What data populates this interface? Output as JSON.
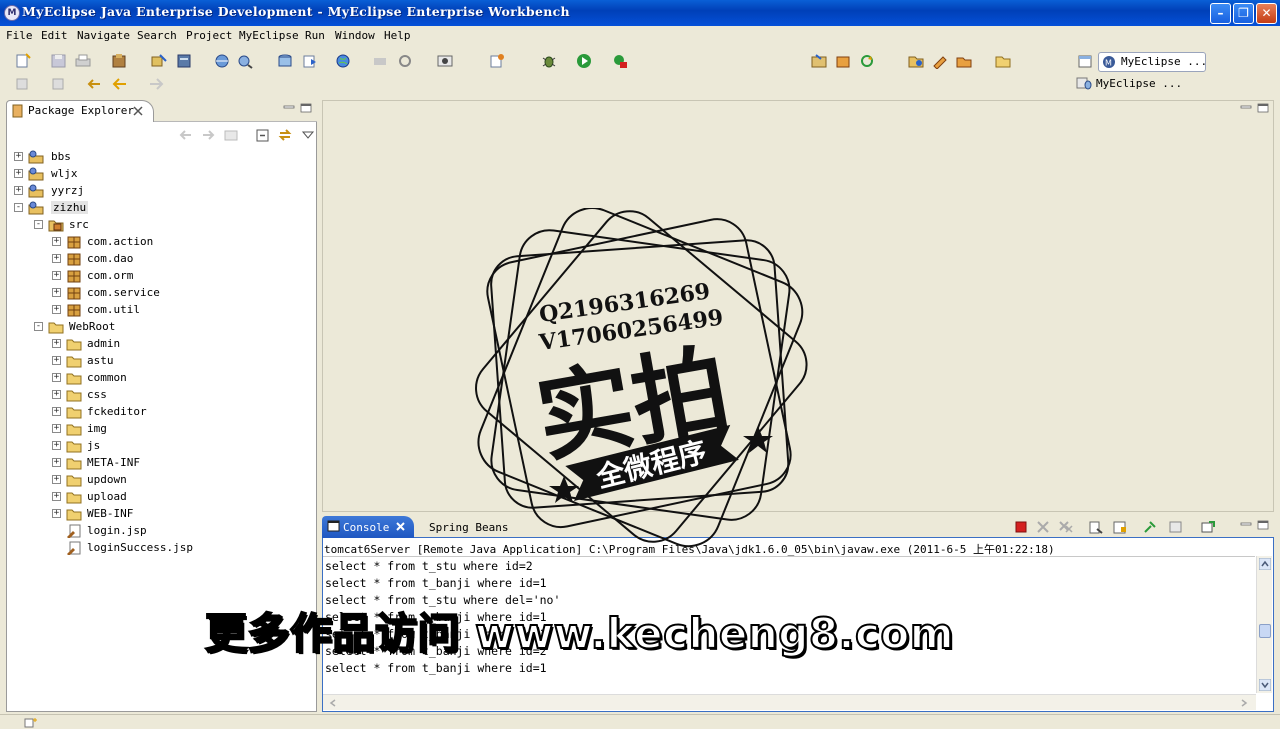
{
  "window": {
    "title": "MyEclipse Java Enterprise Development - MyEclipse Enterprise Workbench",
    "icon": "myeclipse-logo-icon"
  },
  "menu": [
    "File",
    "Edit",
    "Navigate",
    "Search",
    "Project",
    "MyEclipse",
    "Run",
    "Window",
    "Help"
  ],
  "perspective": {
    "active_label": "MyEclipse ...",
    "secondary_label": "MyEclipse ..."
  },
  "package_explorer": {
    "title": "Package Explorer",
    "tree": [
      {
        "label": "bbs",
        "icon": "project-icon",
        "level": 0,
        "toggle": "+"
      },
      {
        "label": "wljx",
        "icon": "project-icon",
        "level": 0,
        "toggle": "+"
      },
      {
        "label": "yyrzj",
        "icon": "project-icon",
        "level": 0,
        "toggle": "+"
      },
      {
        "label": "zizhu",
        "icon": "project-icon",
        "level": 0,
        "toggle": "-",
        "selected": true
      },
      {
        "label": "src",
        "icon": "source-folder-icon",
        "level": 1,
        "toggle": "-"
      },
      {
        "label": "com.action",
        "icon": "package-icon",
        "level": 2,
        "toggle": "+"
      },
      {
        "label": "com.dao",
        "icon": "package-icon",
        "level": 2,
        "toggle": "+"
      },
      {
        "label": "com.orm",
        "icon": "package-icon",
        "level": 2,
        "toggle": "+"
      },
      {
        "label": "com.service",
        "icon": "package-icon",
        "level": 2,
        "toggle": "+"
      },
      {
        "label": "com.util",
        "icon": "package-icon",
        "level": 2,
        "toggle": "+"
      },
      {
        "label": "WebRoot",
        "icon": "folder-icon",
        "level": 1,
        "toggle": "-"
      },
      {
        "label": "admin",
        "icon": "folder-icon",
        "level": 2,
        "toggle": "+"
      },
      {
        "label": "astu",
        "icon": "folder-icon",
        "level": 2,
        "toggle": "+"
      },
      {
        "label": "common",
        "icon": "folder-icon",
        "level": 2,
        "toggle": "+"
      },
      {
        "label": "css",
        "icon": "folder-icon",
        "level": 2,
        "toggle": "+"
      },
      {
        "label": "fckeditor",
        "icon": "folder-icon",
        "level": 2,
        "toggle": "+"
      },
      {
        "label": "img",
        "icon": "folder-icon",
        "level": 2,
        "toggle": "+"
      },
      {
        "label": "js",
        "icon": "folder-icon",
        "level": 2,
        "toggle": "+"
      },
      {
        "label": "META-INF",
        "icon": "folder-icon",
        "level": 2,
        "toggle": "+"
      },
      {
        "label": "updown",
        "icon": "folder-icon",
        "level": 2,
        "toggle": "+"
      },
      {
        "label": "upload",
        "icon": "folder-icon",
        "level": 2,
        "toggle": "+"
      },
      {
        "label": "WEB-INF",
        "icon": "folder-icon",
        "level": 2,
        "toggle": "+"
      },
      {
        "label": "login.jsp",
        "icon": "jsp-file-icon",
        "level": 2,
        "toggle": ""
      },
      {
        "label": "loginSuccess.jsp",
        "icon": "jsp-file-icon",
        "level": 2,
        "toggle": ""
      }
    ]
  },
  "console": {
    "tabs": [
      "Console",
      "Spring Beans"
    ],
    "header": "tomcat6Server [Remote Java Application] C:\\Program Files\\Java\\jdk1.6.0_05\\bin\\javaw.exe (2011-6-5 上午01:22:18)",
    "lines": [
      "select * from t_stu where id=2",
      "select * from t_banji where id=1",
      "select * from t_stu where del='no'",
      "select * from t_banji where id=1",
      "select * from t_banji where id=1",
      "select * from t_banji where id=2",
      "select * from t_banji where id=1"
    ]
  },
  "watermark": {
    "contact_q": "Q2196316269",
    "contact_v": "V17060256499",
    "big_text": "实拍",
    "ribbon_text": "全微程序",
    "url_text": "更多作品访问 www.kecheng8.com"
  },
  "colors": {
    "titlebar": "#0a5fd6",
    "console_tab": "#2a62c9",
    "chrome": "#ece9d8",
    "stop_button": "#d42020"
  }
}
